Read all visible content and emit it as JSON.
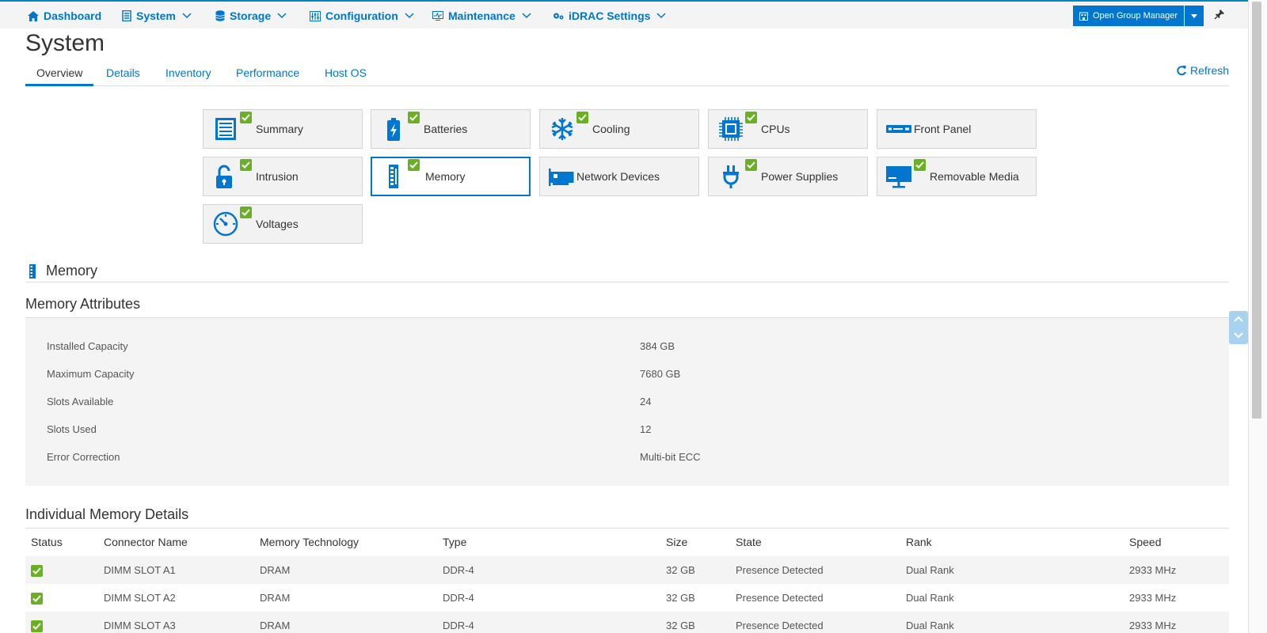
{
  "nav": {
    "items": [
      {
        "label": "Dashboard",
        "icon": "home-icon"
      },
      {
        "label": "System",
        "icon": "server-icon"
      },
      {
        "label": "Storage",
        "icon": "database-icon"
      },
      {
        "label": "Configuration",
        "icon": "sliders-icon"
      },
      {
        "label": "Maintenance",
        "icon": "monitor-pulse-icon"
      },
      {
        "label": "iDRAC Settings",
        "icon": "gears-icon"
      }
    ],
    "group_manager_label": "Open Group Manager"
  },
  "page": {
    "title": "System",
    "refresh_label": "Refresh"
  },
  "tabs": [
    "Overview",
    "Details",
    "Inventory",
    "Performance",
    "Host OS"
  ],
  "tiles": [
    {
      "label": "Summary",
      "icon": "list-icon",
      "healthy": true
    },
    {
      "label": "Batteries",
      "icon": "battery-icon",
      "healthy": true
    },
    {
      "label": "Cooling",
      "icon": "snowflake-icon",
      "healthy": true
    },
    {
      "label": "CPUs",
      "icon": "cpu-icon",
      "healthy": true
    },
    {
      "label": "Front Panel",
      "icon": "front-panel-icon",
      "healthy": false
    },
    {
      "label": "Intrusion",
      "icon": "unlock-icon",
      "healthy": true
    },
    {
      "label": "Memory",
      "icon": "memory-icon",
      "healthy": true,
      "selected": true
    },
    {
      "label": "Network Devices",
      "icon": "network-card-icon",
      "healthy": false
    },
    {
      "label": "Power Supplies",
      "icon": "plug-icon",
      "healthy": true
    },
    {
      "label": "Removable Media",
      "icon": "removable-media-icon",
      "healthy": true
    },
    {
      "label": "Voltages",
      "icon": "gauge-icon",
      "healthy": true
    }
  ],
  "memory": {
    "section_title": "Memory",
    "attributes_title": "Memory Attributes",
    "attributes": [
      {
        "key": "Installed Capacity",
        "value": "384 GB"
      },
      {
        "key": "Maximum Capacity",
        "value": "7680 GB"
      },
      {
        "key": "Slots Available",
        "value": "24"
      },
      {
        "key": "Slots Used",
        "value": "12"
      },
      {
        "key": "Error Correction",
        "value": "Multi-bit ECC"
      }
    ],
    "details_title": "Individual Memory Details",
    "columns": [
      "Status",
      "Connector Name",
      "Memory Technology",
      "Type",
      "Size",
      "State",
      "Rank",
      "Speed"
    ],
    "rows": [
      {
        "connector": "DIMM SLOT A1",
        "technology": "DRAM",
        "type": "DDR-4",
        "size": "32 GB",
        "state": "Presence Detected",
        "rank": "Dual Rank",
        "speed": "2933 MHz"
      },
      {
        "connector": "DIMM SLOT A2",
        "technology": "DRAM",
        "type": "DDR-4",
        "size": "32 GB",
        "state": "Presence Detected",
        "rank": "Dual Rank",
        "speed": "2933 MHz"
      },
      {
        "connector": "DIMM SLOT A3",
        "technology": "DRAM",
        "type": "DDR-4",
        "size": "32 GB",
        "state": "Presence Detected",
        "rank": "Dual Rank",
        "speed": "2933 MHz"
      }
    ]
  },
  "colors": {
    "accent": "#0076ce",
    "ok": "#6ab023",
    "panel": "#f4f4f4"
  }
}
